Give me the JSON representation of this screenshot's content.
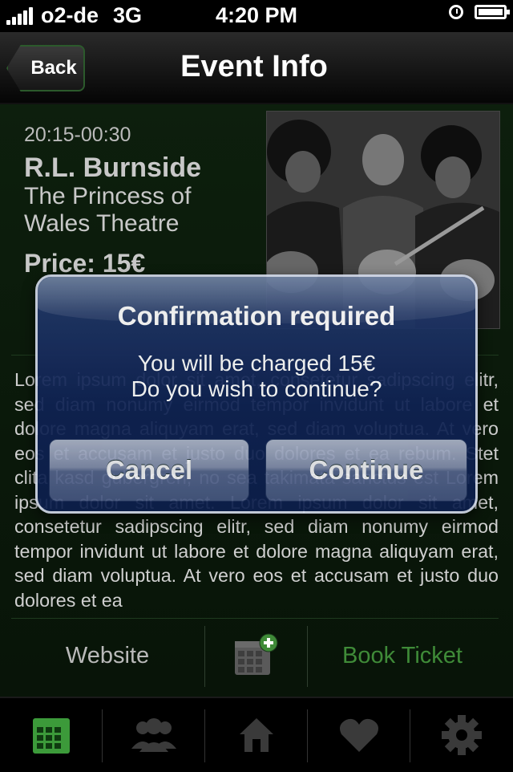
{
  "status_bar": {
    "carrier": "o2-de",
    "network": "3G",
    "time": "4:20 PM"
  },
  "nav": {
    "back_label": "Back",
    "title": "Event Info"
  },
  "event": {
    "time": "20:15-00:30",
    "artist": "R.L. Burnside",
    "venue": "The Princess of Wales Theatre",
    "price": "Price: 15€",
    "description": "Lorem ipsum dolor sit amet, consetetur sadipscing elitr, sed diam nonumy eirmod tempor invidunt ut labore et dolore magna aliquyam erat, sed diam voluptua. At vero eos et accusam et justo duo dolores et ea rebum. Stet clita kasd gubergren, no sea takimata sanctus est Lorem ipsum dolor sit amet. Lorem ipsum dolor sit amet, consetetur sadipscing elitr, sed diam nonumy eirmod tempor invidunt ut labore et dolore magna aliquyam erat, sed diam voluptua. At vero eos et accusam et justo duo dolores et ea"
  },
  "actions": {
    "website_label": "Website",
    "calendar_icon": "calendar-add-icon",
    "book_label": "Book Ticket"
  },
  "tabs": [
    {
      "icon": "calendar-icon",
      "active": true
    },
    {
      "icon": "people-icon",
      "active": false
    },
    {
      "icon": "home-icon",
      "active": false
    },
    {
      "icon": "heart-icon",
      "active": false
    },
    {
      "icon": "gear-icon",
      "active": false
    }
  ],
  "dialog": {
    "title": "Confirmation required",
    "message_line1": "You will be charged 15€",
    "message_line2": "Do you wish to continue?",
    "cancel_label": "Cancel",
    "continue_label": "Continue"
  },
  "colors": {
    "accent_green": "#3f8b38",
    "dialog_blue": "#0f2253",
    "active_tab": "#3c9a3a"
  }
}
